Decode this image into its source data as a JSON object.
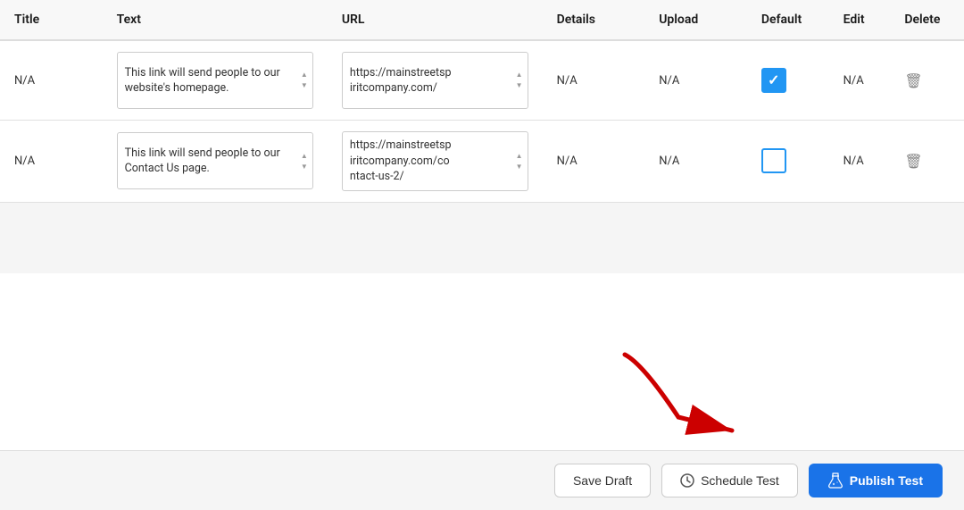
{
  "table": {
    "headers": {
      "title": "Title",
      "text": "Text",
      "url": "URL",
      "details": "Details",
      "upload": "Upload",
      "default": "Default",
      "edit": "Edit",
      "delete": "Delete"
    },
    "rows": [
      {
        "title": "N/A",
        "text": "This link will send people to our website's homepage.",
        "url": "https://mainstreetsp\niritcompany.com/",
        "details": "N/A",
        "upload": "N/A",
        "default_checked": true,
        "edit": "N/A"
      },
      {
        "title": "N/A",
        "text": "This link will send people to our Contact Us page.",
        "url": "https://mainstreetsp\niritcompany.com/co\nntact-us-2/",
        "details": "N/A",
        "upload": "N/A",
        "default_checked": false,
        "edit": "N/A"
      }
    ]
  },
  "footer": {
    "save_draft_label": "Save Draft",
    "schedule_label": "Schedule Test",
    "publish_label": "Publish Test"
  }
}
